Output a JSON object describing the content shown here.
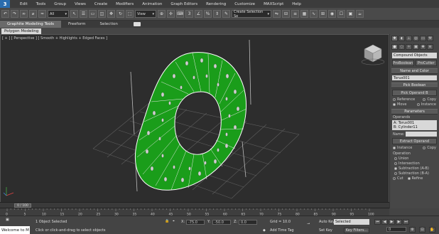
{
  "app": {
    "logo_label": "3"
  },
  "menu": {
    "items": [
      "Edit",
      "Tools",
      "Group",
      "Views",
      "Create",
      "Modifiers",
      "Animation",
      "Graph Editors",
      "Rendering",
      "Customize",
      "MAXScript",
      "Help"
    ]
  },
  "toolbar": {
    "selection_filter": "All",
    "ref_coord": "View",
    "named_selection": "Create Selection Se"
  },
  "ribbon": {
    "tabs": [
      "Graphite Modeling Tools",
      "Freeform",
      "Selection"
    ],
    "subtab": "Polygon Modeling"
  },
  "viewport": {
    "label": "[ + ] [ Perspective ] [ Smooth + Highlights + Edged Faces ]",
    "object_color": "#1a9d1a"
  },
  "command_panel": {
    "category_dropdown": "Compound Objects",
    "object_types": [
      "ProBoolean",
      "ProCutter"
    ],
    "name_and_color_header": "Name and Color",
    "object_name": "Torus001",
    "pick_boolean_header": "Pick Boolean",
    "pick_operand_button": "Pick Operand B",
    "pick_options_left": [
      "Reference",
      "Move"
    ],
    "pick_options_right": [
      "Copy",
      "Instance"
    ],
    "parameters_header": "Parameters",
    "operands_label": "Operands",
    "operands_list": [
      "A: Torus001",
      "B: Cylinder11"
    ],
    "name_label": "Name:",
    "extract_operand_button": "Extract Operand",
    "extract_options": [
      "Instance",
      "Copy"
    ],
    "operation_label": "Operation",
    "operations": [
      "Union",
      "Intersection",
      "Subtraction (A-B)",
      "Subtraction (B-A)"
    ],
    "cut_options": [
      "Cut",
      "Refine"
    ]
  },
  "timeline": {
    "frame_display": "0 / 100",
    "ticks": [
      "0",
      "5",
      "10",
      "15",
      "20",
      "25",
      "30",
      "35",
      "40",
      "45",
      "50",
      "55",
      "60",
      "65",
      "70",
      "75",
      "80",
      "85",
      "90",
      "95",
      "100"
    ]
  },
  "status": {
    "welcome": "Welcome to M",
    "objects_selected": "1 Object Selected",
    "prompt": "Click or click-and-drag to select objects",
    "x_label": "X:",
    "x_value": "-75.0",
    "y_label": "Y:",
    "y_value": "-50.0",
    "z_label": "Z:",
    "z_value": "0.0",
    "grid": "Grid = 10.0",
    "add_time_tag": "Add Time Tag",
    "auto_key": "Auto Key",
    "set_key": "Set Key",
    "key_mode_select": "Selected",
    "key_filters": "Key Filters...",
    "current_frame": "0"
  }
}
